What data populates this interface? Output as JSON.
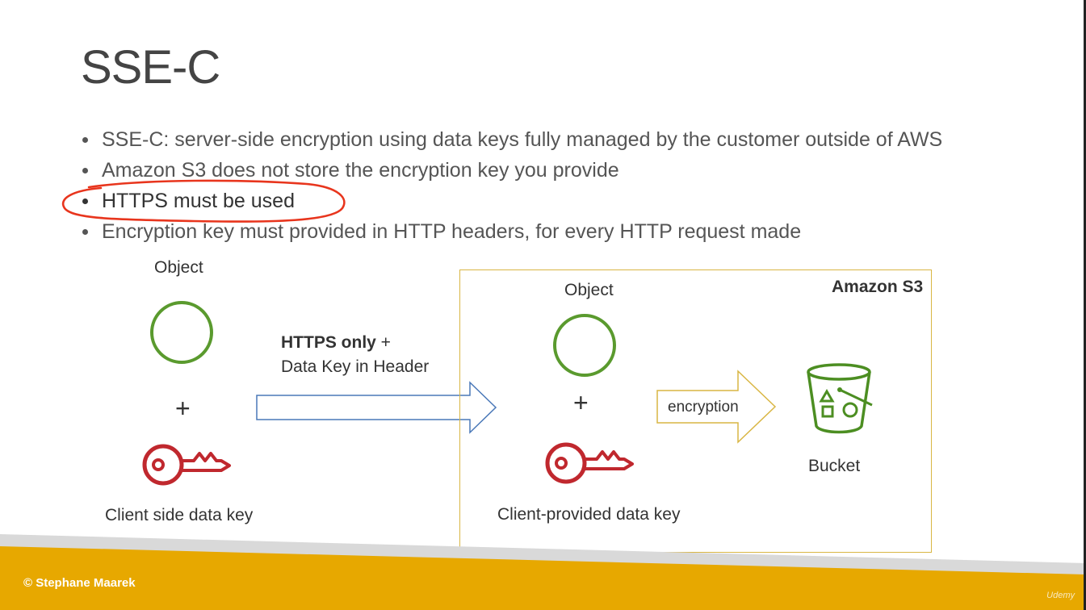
{
  "slide": {
    "title": "SSE-C",
    "bullets": [
      "SSE-C: server-side encryption using data keys fully managed by the customer outside of AWS",
      "Amazon S3 does not store the encryption key you provide",
      "HTTPS must be used",
      "Encryption key must provided in HTTP headers, for every HTTP request made"
    ]
  },
  "diagram": {
    "client": {
      "object_label": "Object",
      "plus": "+",
      "key_label": "Client side data key"
    },
    "transfer": {
      "line1_bold": "HTTPS only",
      "line1_rest": " +",
      "line2": "Data Key in Header"
    },
    "s3": {
      "box_label": "Amazon S3",
      "object_label": "Object",
      "plus": "+",
      "encryption_label": "encryption",
      "bucket_label": "Bucket",
      "key_label": "Client-provided data key"
    }
  },
  "footer": {
    "copyright": "© Stephane Maarek",
    "watermark": "Udemy"
  },
  "colors": {
    "object_circle": "#5a9a2e",
    "key_red": "#c0282e",
    "bucket_green": "#4c8e22",
    "arrow_blue": "#4a78b8",
    "arrow_gold": "#d9b644",
    "highlight_red": "#e8351d",
    "footer_gold": "#e7a800"
  }
}
